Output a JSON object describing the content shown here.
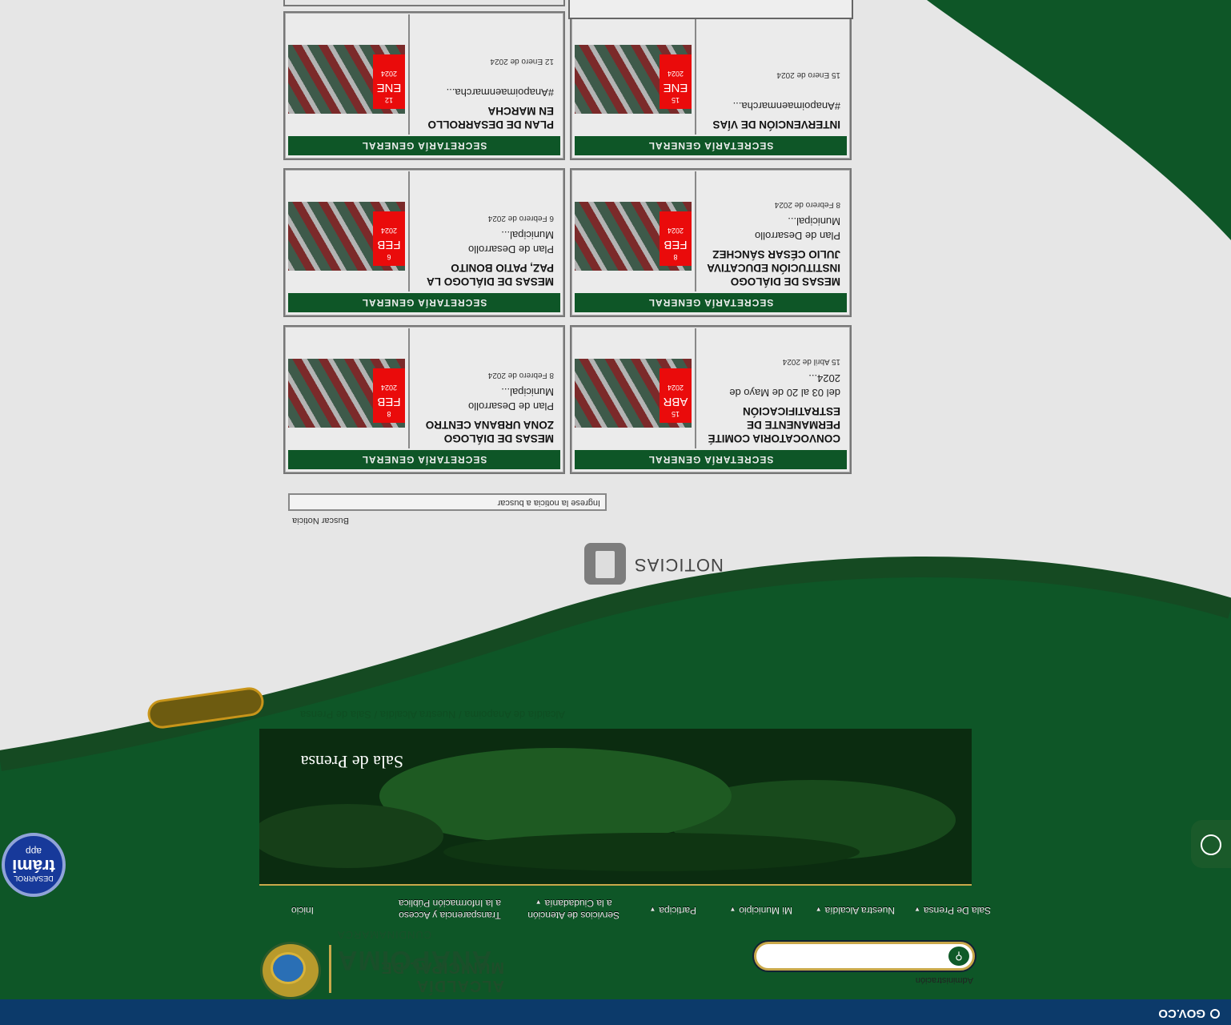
{
  "gov_bar": {
    "label": "GOV.CO"
  },
  "header": {
    "admin_link": "Administración",
    "search_placeholder": "",
    "logo_line1": "ALCALDÍA MUNICIPAL DE",
    "logo_line2": "ANAPOIMA",
    "logo_line3": "CUNDINAMARCA"
  },
  "nav": {
    "items": [
      {
        "label": "Inicio"
      },
      {
        "label_line1": "Transparencia y Acceso",
        "label_line2": "a la Información Pública"
      },
      {
        "label_line1": "Servicios de Atención",
        "label_line2": "a la Ciudadanía"
      },
      {
        "label": "Participa"
      },
      {
        "label": "Mi Municipio"
      },
      {
        "label": "Nuestra Alcaldía"
      },
      {
        "label": "Sala De Prensa"
      }
    ]
  },
  "banner": {
    "title": "Sala de Prensa"
  },
  "breadcrumb": {
    "text": "Alcaldía de Anapoima / Nuestra Alcaldía / Sala de Prensa"
  },
  "trami": {
    "top": "app",
    "main": "trámi",
    "bottom": "DESARROL"
  },
  "news": {
    "heading": "NOTICIAS",
    "search_label": "Buscar Noticia",
    "search_placeholder": "Ingrese la noticia a buscar",
    "cards": [
      {
        "category": "SECRETARÍA GENERAL",
        "title": [
          "CONVOCATORIA COMITÉ",
          "PERMANENTE DE",
          "ESTRATIFICACIÓN"
        ],
        "excerpt": "del 03 al 20 de Mayo de 2024...",
        "published": "15 Abril de 2024",
        "day": "15",
        "month": "ABR",
        "year": "2024"
      },
      {
        "category": "SECRETARÍA GENERAL",
        "title": [
          "MESAS DE DIÁLOGO",
          "ZONA URBANA CENTRO"
        ],
        "excerpt": "Plan de Desarrollo Municipal...",
        "published": "8 Febrero de 2024",
        "day": "8",
        "month": "FEB",
        "year": "2024"
      },
      {
        "category": "SECRETARÍA GENERAL",
        "title": [
          "MESAS DE DIÁLOGO",
          "INSTITUCIÓN EDUCATIVA",
          "JULIO CÉSAR SÁNCHEZ"
        ],
        "excerpt": "Plan de Desarrollo Municipal...",
        "published": "8 Febrero de 2024",
        "day": "8",
        "month": "FEB",
        "year": "2024"
      },
      {
        "category": "SECRETARÍA GENERAL",
        "title": [
          "MESAS DE DIÁLOGO LA",
          "PAZ, PATIO BONITO"
        ],
        "excerpt": "Plan de Desarrollo Municipal...",
        "published": "6 Febrero de 2024",
        "day": "6",
        "month": "FEB",
        "year": "2024"
      },
      {
        "category": "SECRETARÍA GENERAL",
        "title": [
          "INTERVENCIÓN DE VÍAS"
        ],
        "excerpt": "#Anapoimaenmarcha...",
        "published": "15 Enero de 2024",
        "day": "15",
        "month": "ENE",
        "year": "2024"
      },
      {
        "category": "SECRETARÍA GENERAL",
        "title": [
          "PLAN DE DESARROLLO",
          "EN MARCHA"
        ],
        "excerpt": "#Anapoimaenmarcha...",
        "published": "12 Enero de 2024",
        "day": "12",
        "month": "ENE",
        "year": "2024"
      }
    ]
  },
  "colors": {
    "green": "#0e5627",
    "date_red": "#ea0b0b",
    "gov_blue": "#0c3a6a",
    "gold": "#c9a84a"
  }
}
